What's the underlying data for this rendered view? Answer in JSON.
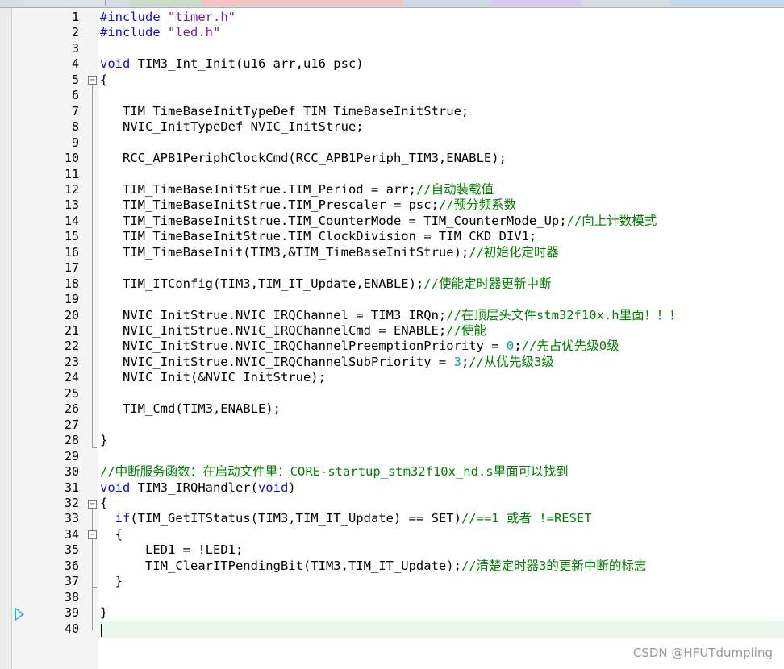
{
  "editor": {
    "lines": [
      {
        "n": "1",
        "html": "<span class=\"pp\">#include</span> <span class=\"str\">\"timer.h\"</span>"
      },
      {
        "n": "2",
        "html": "<span class=\"pp\">#include</span> <span class=\"str\">\"led.h\"</span>"
      },
      {
        "n": "3",
        "html": ""
      },
      {
        "n": "4",
        "html": "<span class=\"kw\">void</span> TIM3_Int_Init(u16 arr,u16 psc)"
      },
      {
        "n": "5",
        "html": "{"
      },
      {
        "n": "6",
        "html": ""
      },
      {
        "n": "7",
        "html": "   TIM_TimeBaseInitTypeDef TIM_TimeBaseInitStrue;"
      },
      {
        "n": "8",
        "html": "   NVIC_InitTypeDef NVIC_InitStrue;"
      },
      {
        "n": "9",
        "html": ""
      },
      {
        "n": "10",
        "html": "   RCC_APB1PeriphClockCmd(RCC_APB1Periph_TIM3,ENABLE);"
      },
      {
        "n": "11",
        "html": ""
      },
      {
        "n": "12",
        "html": "   TIM_TimeBaseInitStrue.TIM_Period = arr;<span class=\"cm\">//自动装载值</span>"
      },
      {
        "n": "13",
        "html": "   TIM_TimeBaseInitStrue.TIM_Prescaler = psc;<span class=\"cm\">//预分频系数</span>"
      },
      {
        "n": "14",
        "html": "   TIM_TimeBaseInitStrue.TIM_CounterMode = TIM_CounterMode_Up;<span class=\"cm\">//向上计数模式</span>"
      },
      {
        "n": "15",
        "html": "   TIM_TimeBaseInitStrue.TIM_ClockDivision = TIM_CKD_DIV1;"
      },
      {
        "n": "16",
        "html": "   TIM_TimeBaseInit(TIM3,&amp;TIM_TimeBaseInitStrue);<span class=\"cm\">//初始化定时器</span>"
      },
      {
        "n": "17",
        "html": ""
      },
      {
        "n": "18",
        "html": "   TIM_ITConfig(TIM3,TIM_IT_Update,ENABLE);<span class=\"cm\">//使能定时器更新中断</span>"
      },
      {
        "n": "19",
        "html": ""
      },
      {
        "n": "20",
        "html": "   NVIC_InitStrue.NVIC_IRQChannel = TIM3_IRQn;<span class=\"cm\">//在顶层头文件stm32f10x.h里面！！！</span>"
      },
      {
        "n": "21",
        "html": "   NVIC_InitStrue.NVIC_IRQChannelCmd = ENABLE;<span class=\"cm\">//使能</span>"
      },
      {
        "n": "22",
        "html": "   NVIC_InitStrue.NVIC_IRQChannelPreemptionPriority = <span class=\"num\">0</span>;<span class=\"cm\">//先占优先级0级</span>"
      },
      {
        "n": "23",
        "html": "   NVIC_InitStrue.NVIC_IRQChannelSubPriority = <span class=\"num\">3</span>;<span class=\"cm\">//从优先级3级</span>"
      },
      {
        "n": "24",
        "html": "   NVIC_Init(&amp;NVIC_InitStrue);"
      },
      {
        "n": "25",
        "html": ""
      },
      {
        "n": "26",
        "html": "   TIM_Cmd(TIM3,ENABLE);"
      },
      {
        "n": "27",
        "html": ""
      },
      {
        "n": "28",
        "html": "}"
      },
      {
        "n": "29",
        "html": ""
      },
      {
        "n": "30",
        "html": "<span class=\"cm\">//中断服务函数：在启动文件里：CORE-startup_stm32f10x_hd.s里面可以找到</span>"
      },
      {
        "n": "31",
        "html": "<span class=\"kw\">void</span> TIM3_IRQHandler(<span class=\"kw\">void</span>)"
      },
      {
        "n": "32",
        "html": "{"
      },
      {
        "n": "33",
        "html": "  <span class=\"kw\">if</span>(TIM_GetITStatus(TIM3,TIM_IT_Update) == SET)<span class=\"cm\">//==1 或者 !=RESET</span>"
      },
      {
        "n": "34",
        "html": "  {"
      },
      {
        "n": "35",
        "html": "      LED1 = !LED1;"
      },
      {
        "n": "36",
        "html": "      TIM_ClearITPendingBit(TIM3,TIM_IT_Update);<span class=\"cm\">//清楚定时器3的更新中断的标志</span>"
      },
      {
        "n": "37",
        "html": "  }"
      },
      {
        "n": "38",
        "html": ""
      },
      {
        "n": "39",
        "html": "}"
      },
      {
        "n": "40",
        "html": ""
      }
    ]
  },
  "watermark": "CSDN @HFUTdumpling"
}
